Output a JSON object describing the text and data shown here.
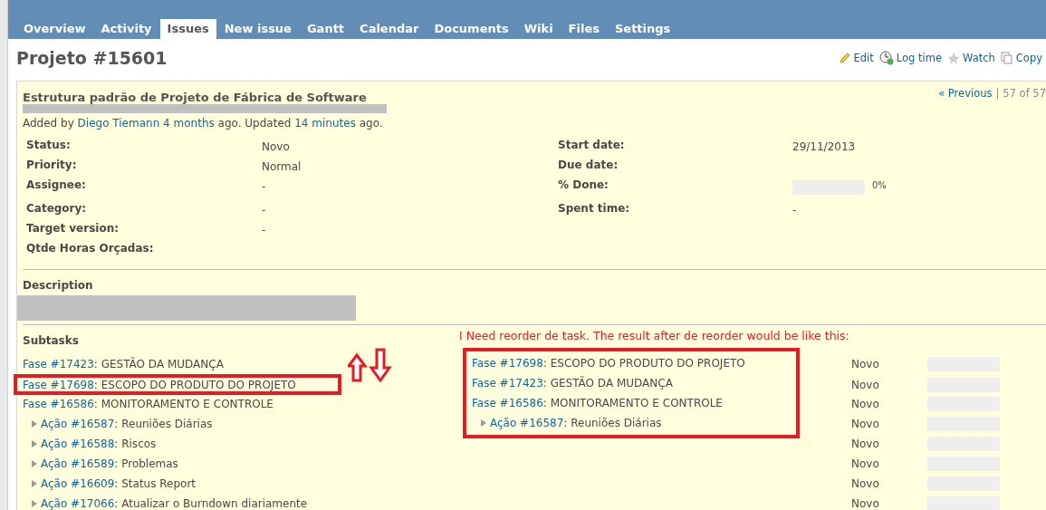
{
  "tabs": [
    {
      "label": "Overview",
      "selected": false
    },
    {
      "label": "Activity",
      "selected": false
    },
    {
      "label": "Issues",
      "selected": true
    },
    {
      "label": "New issue",
      "selected": false
    },
    {
      "label": "Gantt",
      "selected": false
    },
    {
      "label": "Calendar",
      "selected": false
    },
    {
      "label": "Documents",
      "selected": false
    },
    {
      "label": "Wiki",
      "selected": false
    },
    {
      "label": "Files",
      "selected": false
    },
    {
      "label": "Settings",
      "selected": false
    }
  ],
  "title": "Projeto #15601",
  "actions": [
    {
      "kind": "edit",
      "label": "Edit"
    },
    {
      "kind": "log",
      "label": "Log time"
    },
    {
      "kind": "watch",
      "label": "Watch"
    },
    {
      "kind": "copy",
      "label": "Copy"
    }
  ],
  "issue": {
    "subject": "Estrutura padrão de Projeto de Fábrica de Software",
    "nav": {
      "previous": "« Previous",
      "separator": "|",
      "position": "57 of 57"
    },
    "author_line": {
      "prefix": "Added by",
      "author": "Diego Tiemann",
      "created": "4 months",
      "middle": "ago. Updated",
      "updated": "14 minutes",
      "suffix": "ago."
    },
    "attributes_left": [
      {
        "label": "Status:",
        "value": "Novo"
      },
      {
        "label": "Priority:",
        "value": "Normal"
      },
      {
        "label": "Assignee:",
        "value": "-"
      },
      {
        "label": "Category:",
        "value": "-"
      },
      {
        "label": "Target version:",
        "value": "-"
      },
      {
        "label": "Qtde Horas Orçadas:"
      }
    ],
    "attributes_right": [
      {
        "label": "Start date:",
        "value": "29/11/2013"
      },
      {
        "label": "Due date:"
      },
      {
        "label": "% Done:",
        "kind": "progress",
        "level": 0,
        "value": "0%"
      },
      {
        "label": "Spent time:",
        "value": "-"
      }
    ],
    "description_heading": "Description",
    "subtasks_heading": "Subtasks",
    "subtasks": [
      {
        "tracker": "Fase #17423",
        "subject": ": GESTÃO DA MUDANÇA",
        "status": "Novo",
        "level": 0,
        "highlighted": false
      },
      {
        "tracker": "Fase #17698",
        "subject": ": ESCOPO DO PRODUTO DO PROJETO",
        "status": "Novo",
        "level": 0,
        "highlighted": true
      },
      {
        "tracker": "Fase #16586",
        "subject": ": MONITORAMENTO E CONTROLE",
        "status": "Novo",
        "level": 0,
        "highlighted": false,
        "children": [
          {
            "tracker": "Ação #16587",
            "subject": ": Reuniões Diárias",
            "status": "Novo",
            "level": 0,
            "highlighted": false
          },
          {
            "tracker": "Ação #16588",
            "subject": ": Riscos",
            "status": "Novo",
            "level": 0,
            "highlighted": false
          },
          {
            "tracker": "Ação #16589",
            "subject": ": Problemas",
            "status": "Novo",
            "level": 0,
            "highlighted": false
          },
          {
            "tracker": "Ação #16609",
            "subject": ": Status Report",
            "status": "Novo",
            "level": 0,
            "highlighted": false
          },
          {
            "tracker": "Ação #17066",
            "subject": ": Atualizar o Burndown diariamente",
            "status": "Novo",
            "level": 0,
            "highlighted": false
          }
        ]
      }
    ]
  },
  "annotation": {
    "note": "I Need reorder de task. The result after de reorder would be like this:",
    "reordered": [
      {
        "tracker": "Fase #17698",
        "subject": ": ESCOPO DO PRODUTO DO PROJETO"
      },
      {
        "tracker": "Fase #17423",
        "subject": ": GESTÃO DA MUDANÇA"
      },
      {
        "tracker": "Fase #16586",
        "subject": ": MONITORAMENTO E CONTROLE",
        "children": [
          {
            "tracker": "Ação #16587",
            "subject": ": Reuniões Diárias"
          }
        ]
      }
    ]
  }
}
